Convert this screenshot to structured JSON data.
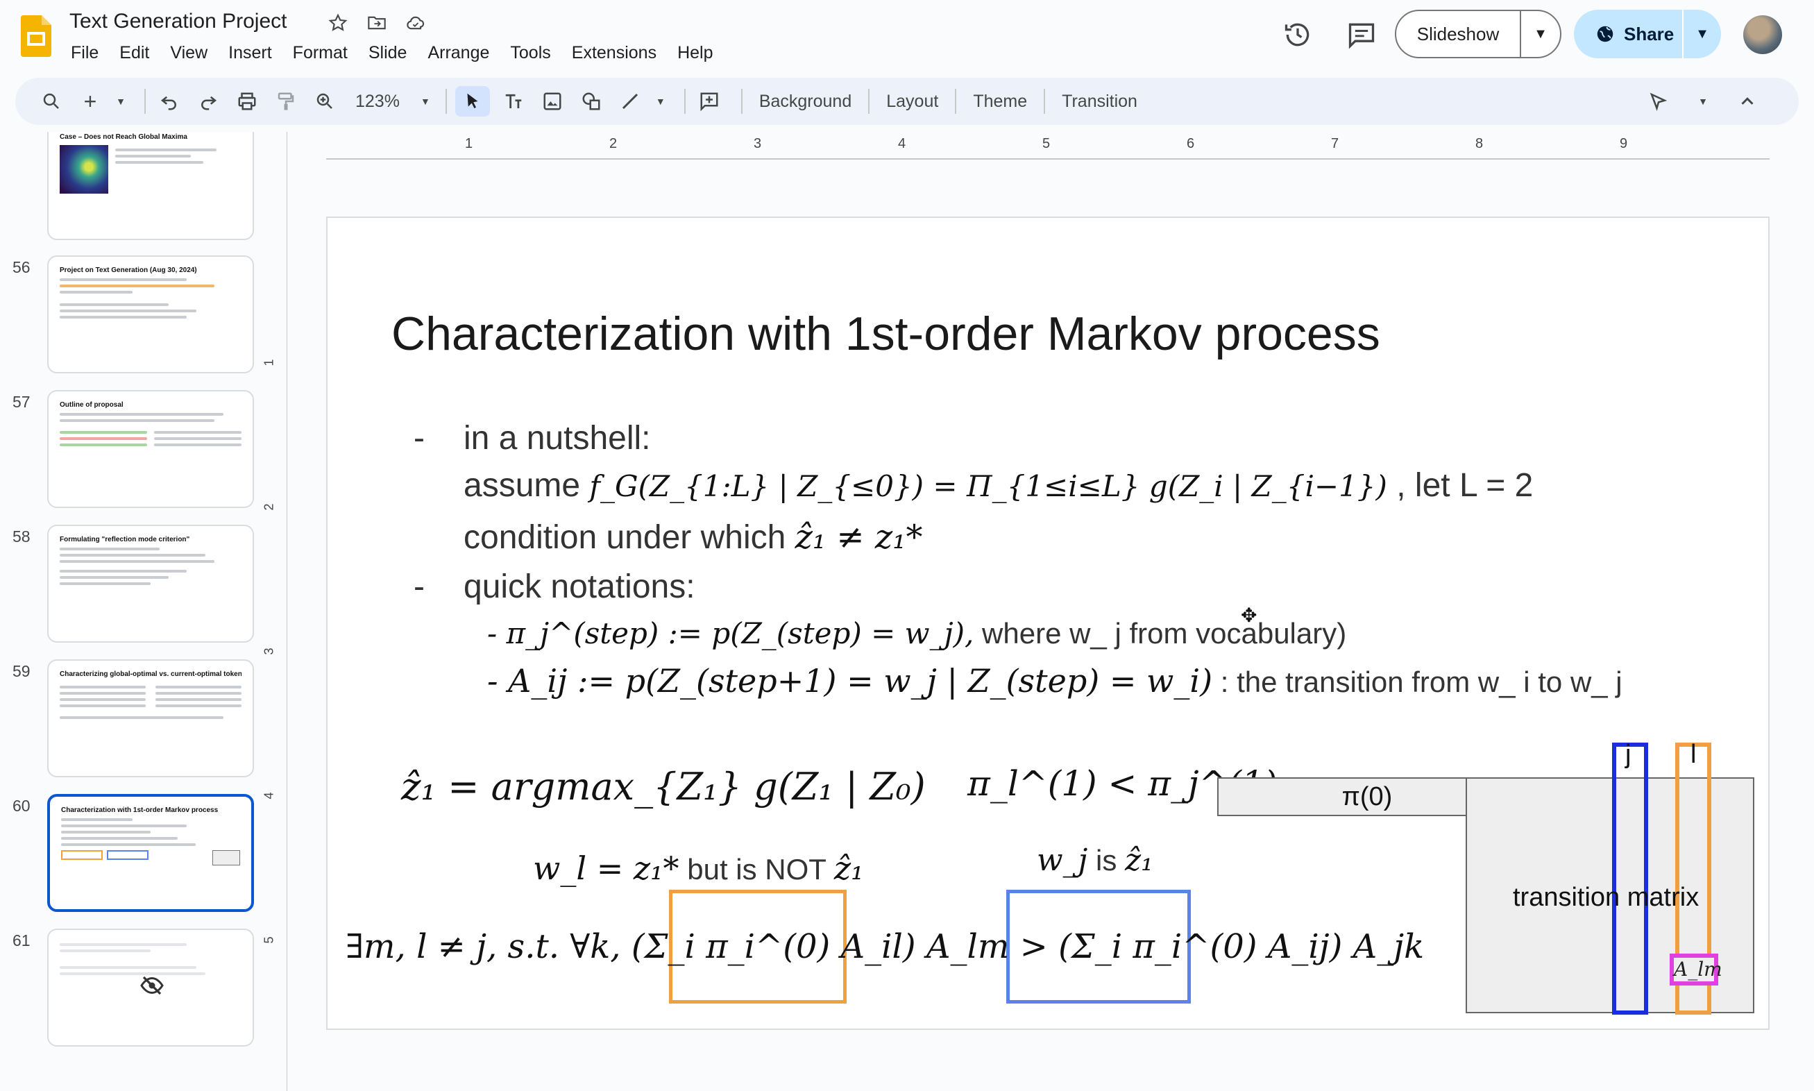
{
  "header": {
    "doc_title": "Text Generation Project",
    "menu": [
      "File",
      "Edit",
      "View",
      "Insert",
      "Format",
      "Slide",
      "Arrange",
      "Tools",
      "Extensions",
      "Help"
    ],
    "slideshow_label": "Slideshow",
    "share_label": "Share"
  },
  "toolbar": {
    "zoom": "123%",
    "background": "Background",
    "layout": "Layout",
    "theme": "Theme",
    "transition": "Transition"
  },
  "ruler": {
    "h": [
      "1",
      "2",
      "3",
      "4",
      "5",
      "6",
      "7",
      "8",
      "9"
    ],
    "v": [
      "1",
      "2",
      "3",
      "4",
      "5"
    ]
  },
  "filmstrip": [
    {
      "num": "",
      "title": "Case – Does not Reach Global Maxima"
    },
    {
      "num": "56",
      "title": "Project on Text Generation (Aug 30, 2024)"
    },
    {
      "num": "57",
      "title": "Outline of proposal"
    },
    {
      "num": "58",
      "title": "Formulating \"reflection mode criterion\""
    },
    {
      "num": "59",
      "title": "Characterizing global-optimal vs. current-optimal tokens"
    },
    {
      "num": "60",
      "title": "Characterization with 1st-order Markov process"
    },
    {
      "num": "61",
      "title": ""
    }
  ],
  "slide": {
    "title": "Characterization with 1st-order Markov process",
    "dash1": "-",
    "dash2": "-",
    "nutshell": "in a nutshell:",
    "assume_prefix": "assume",
    "assume_math": "f_G(Z_{1:L} | Z_{≤0}) = Π_{1≤i≤L} g(Z_i | Z_{i−1})",
    "assume_suffix": ", let L = 2",
    "condition_text": "condition under which",
    "condition_math": "ẑ₁ ≠ z₁*",
    "quick": "quick notations:",
    "pi_def_math": "- π_j^(step) := p(Z_(step) = w_j),",
    "pi_def_text": "where w_ j from vocabulary)",
    "a_def_math": "- A_ij := p(Z_(step+1) = w_j | Z_(step) = w_i)",
    "a_def_text": ": the transition from w_ i to w_ j",
    "argmax_math": "ẑ₁ = argmax_{Z₁} g(Z₁ | Z₀)",
    "pi_ineq_math": "π_l^(1) < π_j^(1)",
    "wl_math": "w_l = z₁*",
    "wl_text": "but is NOT",
    "wl_hat": "ẑ₁",
    "wj_math": "w_j",
    "wj_text": "is",
    "wj_hat": "ẑ₁",
    "exists_math": "∃m, l ≠ j, s.t. ∀k, (Σ_i π_i^(0) A_il) A_lm > (Σ_i π_i^(0) A_ij) A_jk",
    "pi0_box": "π(0)",
    "matrix_label": "transition matrix",
    "col_j": "j",
    "col_l": "l",
    "alm": "A_lm"
  },
  "colors": {
    "accent_blue": "#0b57d0",
    "share_bg": "#c2e7ff",
    "orange_box": "#f0a040",
    "blue_box": "#5a82e8",
    "col_j": "#1a2ee0",
    "alm_box": "#e040e0"
  }
}
